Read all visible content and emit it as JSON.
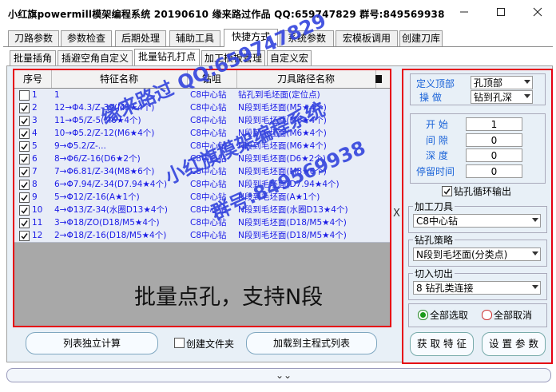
{
  "window": {
    "title": "小红旗powermill模架编程系统 20190610  缘来路过作品 QQ:659747829  群号:849569938"
  },
  "main_tabs": [
    "刀路参数",
    "参数检查",
    "后期处理",
    "辅助工具",
    "快捷方式",
    "系统参数",
    "宏模板调用",
    "创建刀库"
  ],
  "main_tabs_active": 4,
  "sub_tabs": [
    "批量插角",
    "插避空角自定义",
    "批量钻孔打点",
    "加工模板管理",
    "自定义宏"
  ],
  "sub_tabs_active": 2,
  "table": {
    "headers": [
      "序号",
      "特征名称",
      "钻咀",
      "刀具路径名称"
    ],
    "rows": [
      {
        "checked": false,
        "idx": "1",
        "name": "1",
        "tool": "C8中心钻",
        "path": "钻孔到毛坯面(定位点)"
      },
      {
        "checked": true,
        "idx": "2",
        "name": "12→Φ4.3/Z-39(M5★4个)",
        "tool": "C8中心钻",
        "path": "N段到毛坯面(M5★4个)"
      },
      {
        "checked": true,
        "idx": "3",
        "name": "11→Φ5/Z-5(M6★4个)",
        "tool": "C8中心钻",
        "path": "N段到毛坯面(M6★4个)"
      },
      {
        "checked": true,
        "idx": "4",
        "name": "10→Φ5.2/Z-12(M6★4个)",
        "tool": "C8中心钻",
        "path": "N段到毛坯面(M6★4个)"
      },
      {
        "checked": true,
        "idx": "5",
        "name": "9→Φ5.2/Z-...",
        "tool": "C8中心钻",
        "path": "N段到毛坯面(M6★4个)"
      },
      {
        "checked": true,
        "idx": "6",
        "name": "8→Φ6/Z-16(D6★2个)",
        "tool": "C8中心钻",
        "path": "N段到毛坯面(D6★2个)"
      },
      {
        "checked": true,
        "idx": "7",
        "name": "7→Φ6.81/Z-34(M8★6个)",
        "tool": "C8中心钻",
        "path": "N段到毛坯面(M8★6个)"
      },
      {
        "checked": true,
        "idx": "8",
        "name": "6→Φ7.94/Z-34(D7.94★4个)",
        "tool": "C8中心钻",
        "path": "N段到毛坯面(D7.94★4个)"
      },
      {
        "checked": true,
        "idx": "9",
        "name": "5→Φ12/Z-16(A★1个)",
        "tool": "C8中心钻",
        "path": "N段到毛坯面(A★1个)"
      },
      {
        "checked": true,
        "idx": "10",
        "name": "4→Φ13/Z-34(水圈D13★4个)",
        "tool": "C8中心钻",
        "path": "N段到毛坯面(水圈D13★4个)"
      },
      {
        "checked": true,
        "idx": "11",
        "name": "3→Φ18/ZO(D18/M5★4个)",
        "tool": "C8中心钻",
        "path": "N段到毛坯面(D18/M5★4个)"
      },
      {
        "checked": true,
        "idx": "12",
        "name": "2→Φ18/Z-16(D18/M5★4个)",
        "tool": "C8中心钻",
        "path": "N段到毛坯面(D18/M5★4个)"
      }
    ]
  },
  "watermark": {
    "line1": "缘来路过   QQ:659747829",
    "line2": "小红旗模架编程系统",
    "line3": "群号:849569938"
  },
  "right": {
    "define_top_label": "定义顶部",
    "define_top_value": "孔顶部",
    "operation_label": "操    做",
    "operation_value": "钻到孔深",
    "start_label": "开  始",
    "start_value": "1",
    "gap_label": "间  隙",
    "gap_value": "0",
    "depth_label": "深  度",
    "depth_value": "0",
    "dwell_label": "停留时间",
    "dwell_value": "0",
    "cycle_output_label": "钻孔循环输出",
    "cycle_output_checked": true,
    "tool_group": "加工刀具",
    "tool_value": "C8中心钻",
    "strategy_group": "钻孔策略",
    "strategy_value": "N段到毛坯面(分类点)",
    "cutin_group": "切入切出",
    "cutin_value": "8 钻孔类连接",
    "select_all": "全部选取",
    "cancel_all": "全部取消",
    "get_feature_btn": "获 取 特 征",
    "set_params_btn": "设 置 参 数"
  },
  "bottom": {
    "calc_btn": "列表独立计算",
    "create_folder_label": "创建文件夹",
    "load_btn": "加载到主程式列表"
  },
  "annotation": "批量点孔，支持N段",
  "side_letter": "X",
  "colors": {
    "highlight": "#e60012",
    "link": "#1a1ae6",
    "label": "#1a63d8"
  }
}
